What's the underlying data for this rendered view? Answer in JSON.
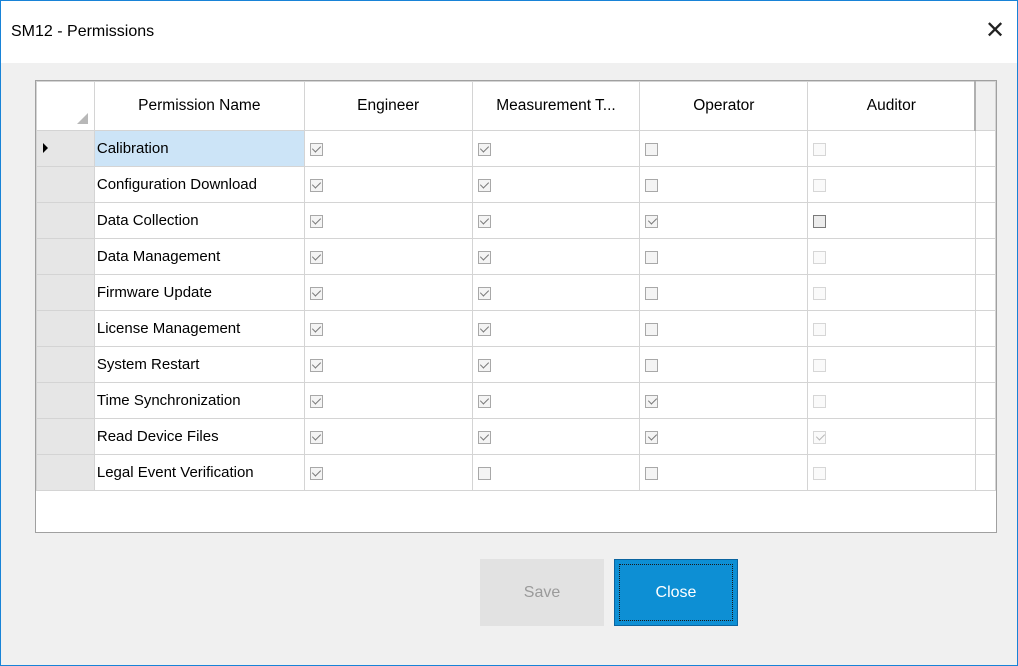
{
  "window": {
    "title": "SM12 - Permissions",
    "close_glyph": "✕"
  },
  "grid": {
    "columns": [
      "Permission Name",
      "Engineer",
      "Measurement T...",
      "Operator",
      "Auditor"
    ],
    "rows": [
      {
        "name": "Calibration",
        "engineer": true,
        "measurement_tech": true,
        "operator": false,
        "auditor": false
      },
      {
        "name": "Configuration Download",
        "engineer": true,
        "measurement_tech": true,
        "operator": false,
        "auditor": false
      },
      {
        "name": "Data Collection",
        "engineer": true,
        "measurement_tech": true,
        "operator": true,
        "auditor": false
      },
      {
        "name": "Data Management",
        "engineer": true,
        "measurement_tech": true,
        "operator": false,
        "auditor": false
      },
      {
        "name": "Firmware Update",
        "engineer": true,
        "measurement_tech": true,
        "operator": false,
        "auditor": false
      },
      {
        "name": "License Management",
        "engineer": true,
        "measurement_tech": true,
        "operator": false,
        "auditor": false
      },
      {
        "name": "System Restart",
        "engineer": true,
        "measurement_tech": true,
        "operator": false,
        "auditor": false
      },
      {
        "name": "Time Synchronization",
        "engineer": true,
        "measurement_tech": true,
        "operator": true,
        "auditor": false
      },
      {
        "name": "Read Device Files",
        "engineer": true,
        "measurement_tech": true,
        "operator": true,
        "auditor": true
      },
      {
        "name": "Legal Event Verification",
        "engineer": true,
        "measurement_tech": false,
        "operator": false,
        "auditor": false
      }
    ],
    "selected_row": 0
  },
  "buttons": {
    "save_label": "Save",
    "close_label": "Close"
  },
  "colors": {
    "accent": "#0d8fd4",
    "selection": "#cce4f7",
    "window_border": "#1883d7"
  }
}
